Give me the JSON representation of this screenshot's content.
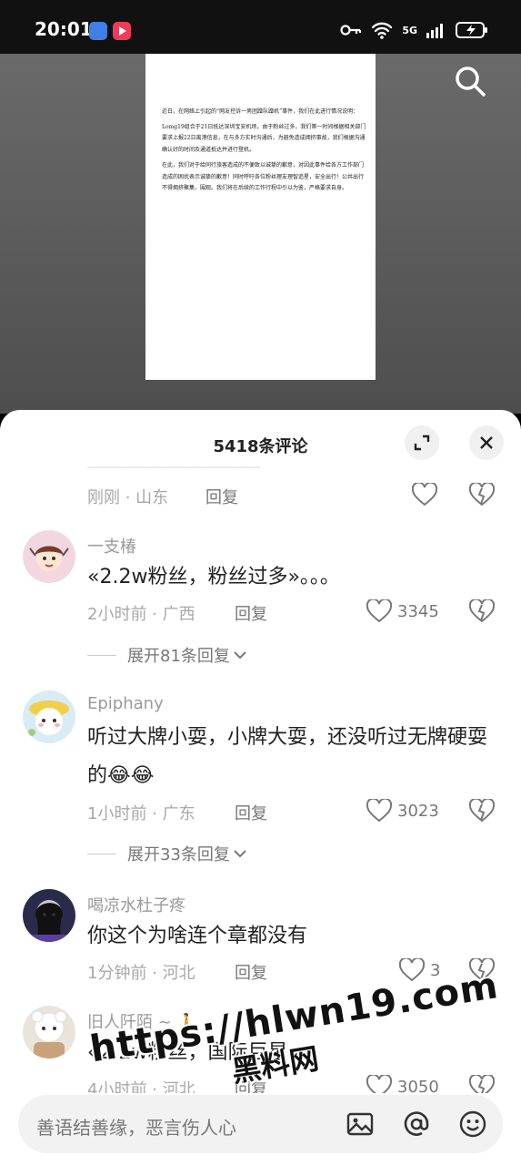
{
  "status_bar": {
    "time": "20:01",
    "network": "5G"
  },
  "document": {
    "paragraphs": [
      "近日，在网络上引起的“网友控诉一男团蹭队蹭机”事件，我们在此进行情况说明：",
      "Lomg19组合于21日抵达深圳宝安机场，由于粉丝过多，我们第一时间根据相关部门要求上报22日离港信息，在与多方实时沟通后，为避免造成拥挤事故，我们根据沟通确认好的时间及通道抵达并进行登机。",
      "在此，我们对于给同行旅客造成的不便致以诚挚的歉意，对因此事件给各方工作部门造成的困扰表示诚挚的歉意！同时呼吁各位粉丝理友理智追星，安全出行！公共出行不得拥挤聚集，围观。我们将在后续的工作行程中引以为鉴，严格要求自身。"
    ]
  },
  "sheet": {
    "title": "5418条评论"
  },
  "comments": [
    {
      "partial": true,
      "meta": "刚刚 · 山东",
      "reply": "回复"
    },
    {
      "username": "一支椿",
      "text": "«2.2w粉丝，粉丝过多»。。。",
      "meta": "2小时前 · 广西",
      "reply": "回复",
      "likes": "3345",
      "expand": "展开81条回复"
    },
    {
      "username": "Epiphany",
      "text": "听过大牌小耍，小牌大耍，还没听过无牌硬耍的😂😂",
      "meta": "1小时前 · 广东",
      "reply": "回复",
      "likes": "3023",
      "expand": "展开33条回复"
    },
    {
      "username": "喝凉水杜子疼",
      "text": "你这个为啥连个章都没有",
      "meta": "1分钟前 · 河北",
      "reply": "回复",
      "likes": "3"
    },
    {
      "username": "旧人阡陌 ~ 🚶",
      "text": "«2.2w粉丝，国际巨星»",
      "meta": "4小时前 · 河北",
      "reply": "回复",
      "likes": "3050"
    }
  ],
  "input": {
    "placeholder": "善语结善缘，恶言伤人心"
  },
  "watermark": {
    "url": "https://hlwn19.com",
    "name": "黑料网"
  }
}
